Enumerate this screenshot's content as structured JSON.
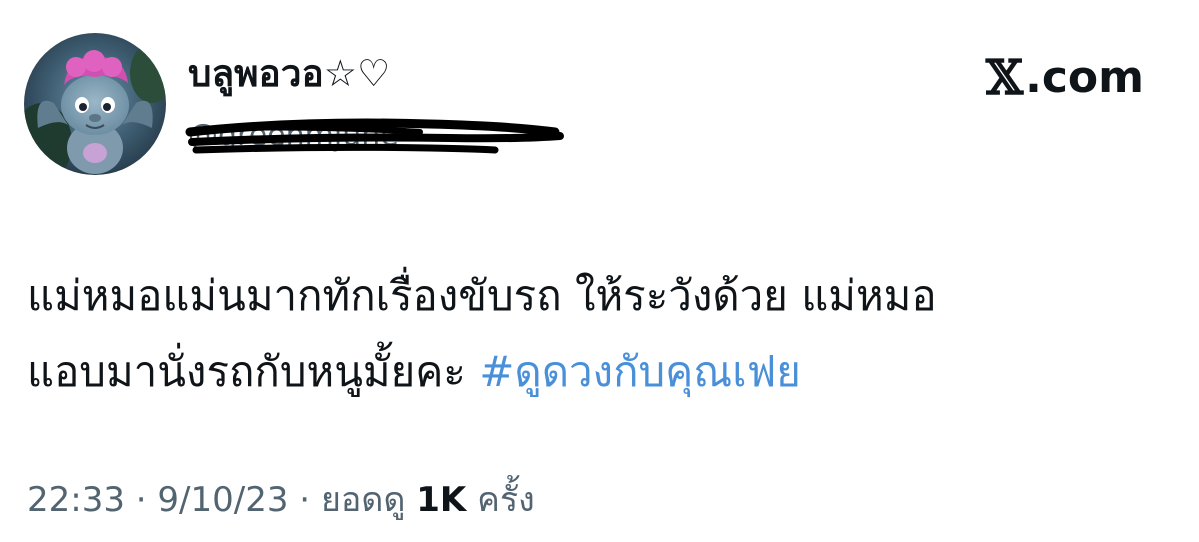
{
  "user": {
    "display_name": "บลูพอวอ☆♡",
    "handle": "@greenmjune"
  },
  "brand": {
    "x_glyph": "𝕏",
    "suffix": ".com"
  },
  "tweet": {
    "text_line_1": "แม่หมอแม่นมากทักเรื่องขับรถ ให้ระวังด้วย แม่หมอ",
    "text_line_2": "แอบมานั่งรถกับหนูมั้ยคะ",
    "hashtag": "#ดูดวงกับคุณเฟย",
    "hashtag_color": "#4a90d9"
  },
  "meta": {
    "time": "22:33",
    "separator_1": " · ",
    "date": "9/10/23",
    "separator_2": " · ",
    "views_label": "ยอดดู",
    "views_count": "1K",
    "views_unit": "ครั้ง"
  },
  "colors": {
    "text": "#0f1419",
    "secondary": "#536471",
    "link": "#4a90d9"
  },
  "icons": {
    "avatar": "cartoon-character-avatar",
    "brand": "x-logo-icon"
  }
}
